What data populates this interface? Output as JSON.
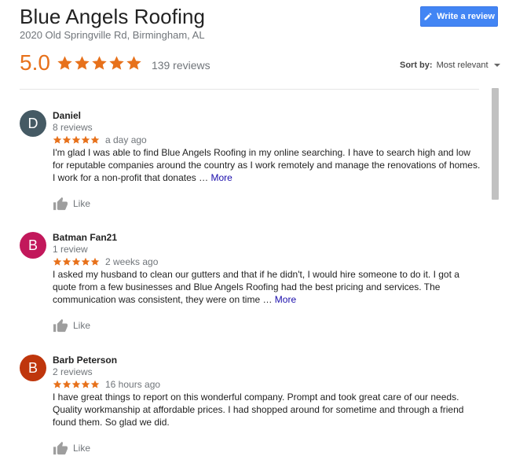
{
  "business": {
    "name": "Blue Angels Roofing",
    "address": "2020 Old Springville Rd, Birmingham, AL",
    "rating": "5.0",
    "reviews_count": "139 reviews"
  },
  "write_review_label": "Write a review",
  "sort": {
    "label": "Sort by:",
    "value": "Most relevant"
  },
  "colors": {
    "accent_star": "#e7711b",
    "button": "#4285f4",
    "link": "#1a0dab"
  },
  "reviews": [
    {
      "initial": "D",
      "avatar_color": "#455a64",
      "name": "Daniel",
      "count": "8 reviews",
      "stars": 5,
      "time": "a day ago",
      "text": "I'm glad I was able to find Blue Angels Roofing in my online searching. I have to search high and low for reputable companies around the country as I work remotely and manage the renovations of homes. I work for a non-profit that donates …",
      "more": "More",
      "like": "Like"
    },
    {
      "initial": "B",
      "avatar_color": "#c2185b",
      "name": "Batman Fan21",
      "count": "1 review",
      "stars": 5,
      "time": "2 weeks ago",
      "text": "I asked my husband to clean our gutters and that if he didn't, I would hire someone to do it. I got a quote from a few businesses and Blue Angels Roofing had the best pricing and services. The communication was consistent, they were on time …",
      "more": "More",
      "like": "Like"
    },
    {
      "initial": "B",
      "avatar_color": "#bf360c",
      "name": "Barb Peterson",
      "count": "2 reviews",
      "stars": 5,
      "time": "16 hours ago",
      "text": "I have great things to report on this wonderful company.  Prompt and took great care of our needs. Quality workmanship at affordable prices.  I had shopped around for sometime and through a friend found them. So glad we did.",
      "more": "",
      "like": "Like"
    }
  ]
}
